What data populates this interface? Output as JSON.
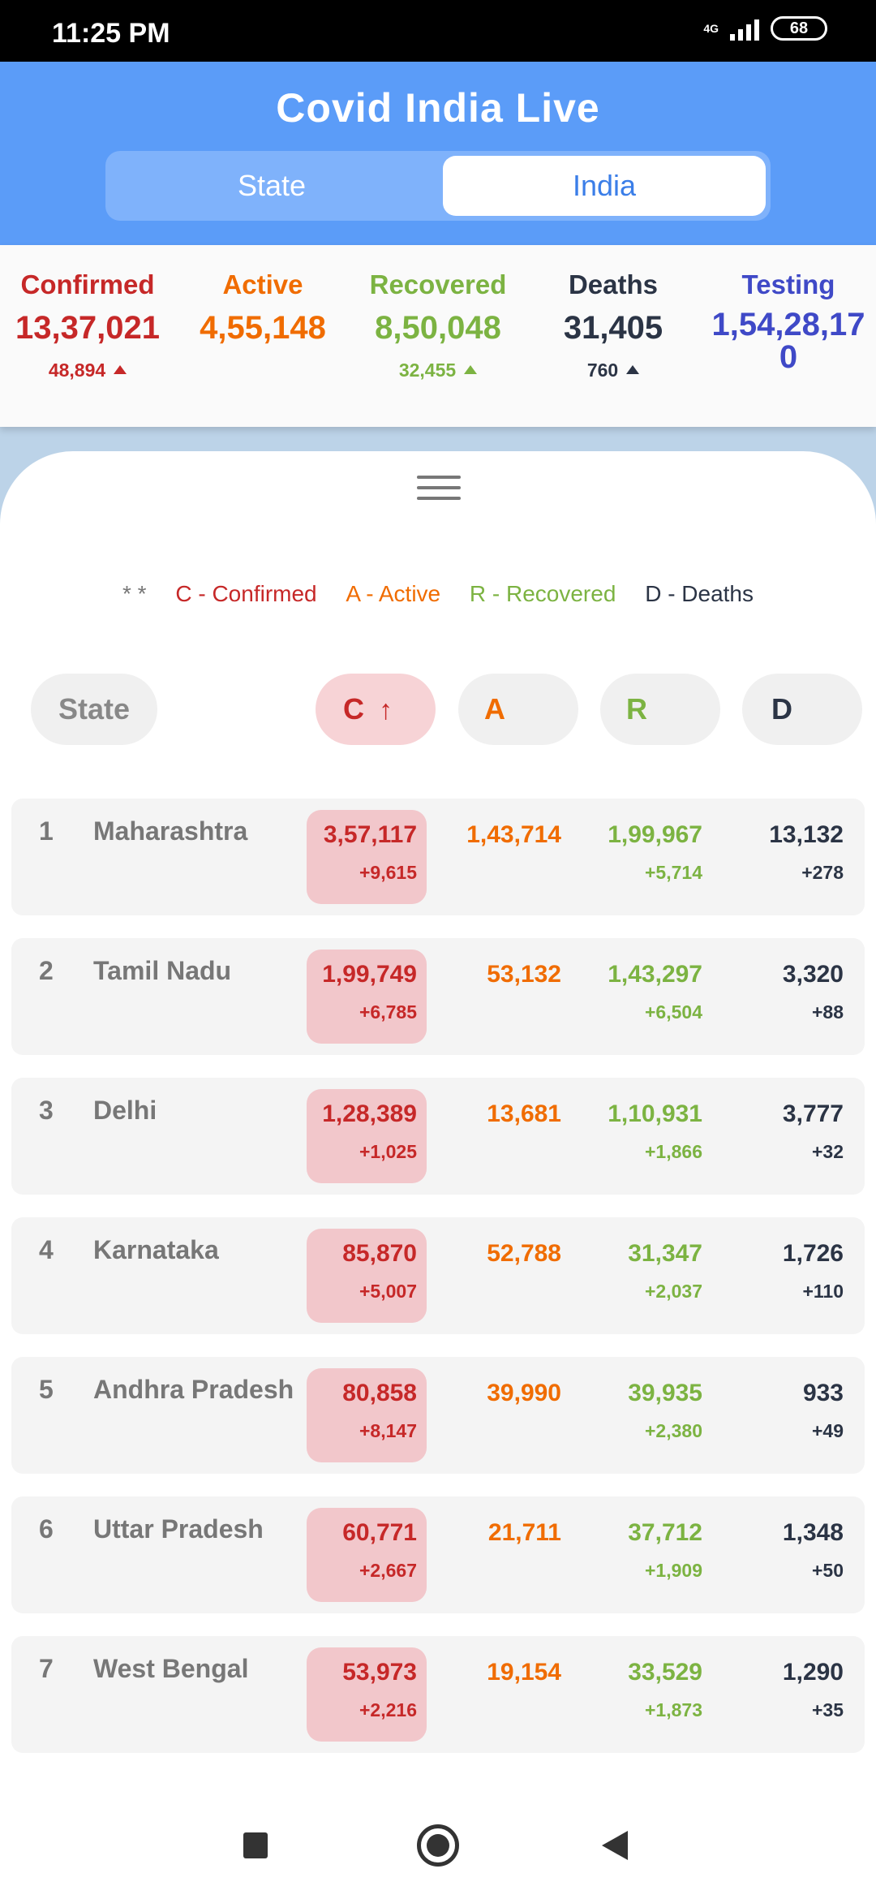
{
  "status_bar": {
    "time": "11:25 PM",
    "network": "4G",
    "battery": "68"
  },
  "header": {
    "title": "Covid India Live",
    "tabs": [
      {
        "label": "State"
      },
      {
        "label": "India"
      }
    ],
    "selected_tab": "India"
  },
  "summary": {
    "confirmed": {
      "label": "Confirmed",
      "value": "13,37,021",
      "delta": "48,894"
    },
    "active": {
      "label": "Active",
      "value": "4,55,148"
    },
    "recovered": {
      "label": "Recovered",
      "value": "8,50,048",
      "delta": "32,455"
    },
    "deaths": {
      "label": "Deaths",
      "value": "31,405",
      "delta": "760"
    },
    "testing": {
      "label": "Testing",
      "value_line1": "1,54,28,17",
      "value_line2": "0"
    }
  },
  "legend": {
    "prefix": "* *",
    "confirmed": "C - Confirmed",
    "active": "A - Active",
    "recovered": "R - Recovered",
    "deaths": "D - Deaths"
  },
  "table": {
    "headers": {
      "state": "State",
      "confirmed": "C",
      "sort_arrow": "↑",
      "active": "A",
      "recovered": "R",
      "deaths": "D"
    },
    "rows": [
      {
        "rank": "1",
        "state": "Maharashtra",
        "confirmed": "3,57,117",
        "confirmed_delta": "+9,615",
        "active": "1,43,714",
        "recovered": "1,99,967",
        "recovered_delta": "+5,714",
        "deaths": "13,132",
        "deaths_delta": "+278"
      },
      {
        "rank": "2",
        "state": "Tamil Nadu",
        "confirmed": "1,99,749",
        "confirmed_delta": "+6,785",
        "active": "53,132",
        "recovered": "1,43,297",
        "recovered_delta": "+6,504",
        "deaths": "3,320",
        "deaths_delta": "+88"
      },
      {
        "rank": "3",
        "state": "Delhi",
        "confirmed": "1,28,389",
        "confirmed_delta": "+1,025",
        "active": "13,681",
        "recovered": "1,10,931",
        "recovered_delta": "+1,866",
        "deaths": "3,777",
        "deaths_delta": "+32"
      },
      {
        "rank": "4",
        "state": "Karnataka",
        "confirmed": "85,870",
        "confirmed_delta": "+5,007",
        "active": "52,788",
        "recovered": "31,347",
        "recovered_delta": "+2,037",
        "deaths": "1,726",
        "deaths_delta": "+110"
      },
      {
        "rank": "5",
        "state": "Andhra Pradesh",
        "confirmed": "80,858",
        "confirmed_delta": "+8,147",
        "active": "39,990",
        "recovered": "39,935",
        "recovered_delta": "+2,380",
        "deaths": "933",
        "deaths_delta": "+49"
      },
      {
        "rank": "6",
        "state": "Uttar Pradesh",
        "confirmed": "60,771",
        "confirmed_delta": "+2,667",
        "active": "21,711",
        "recovered": "37,712",
        "recovered_delta": "+1,909",
        "deaths": "1,348",
        "deaths_delta": "+50"
      },
      {
        "rank": "7",
        "state": "West Bengal",
        "confirmed": "53,973",
        "confirmed_delta": "+2,216",
        "active": "19,154",
        "recovered": "33,529",
        "recovered_delta": "+1,873",
        "deaths": "1,290",
        "deaths_delta": "+35"
      }
    ]
  },
  "nav_bar": {
    "icons": [
      "recents-square-icon",
      "home-circle-icon",
      "back-triangle-icon"
    ]
  }
}
